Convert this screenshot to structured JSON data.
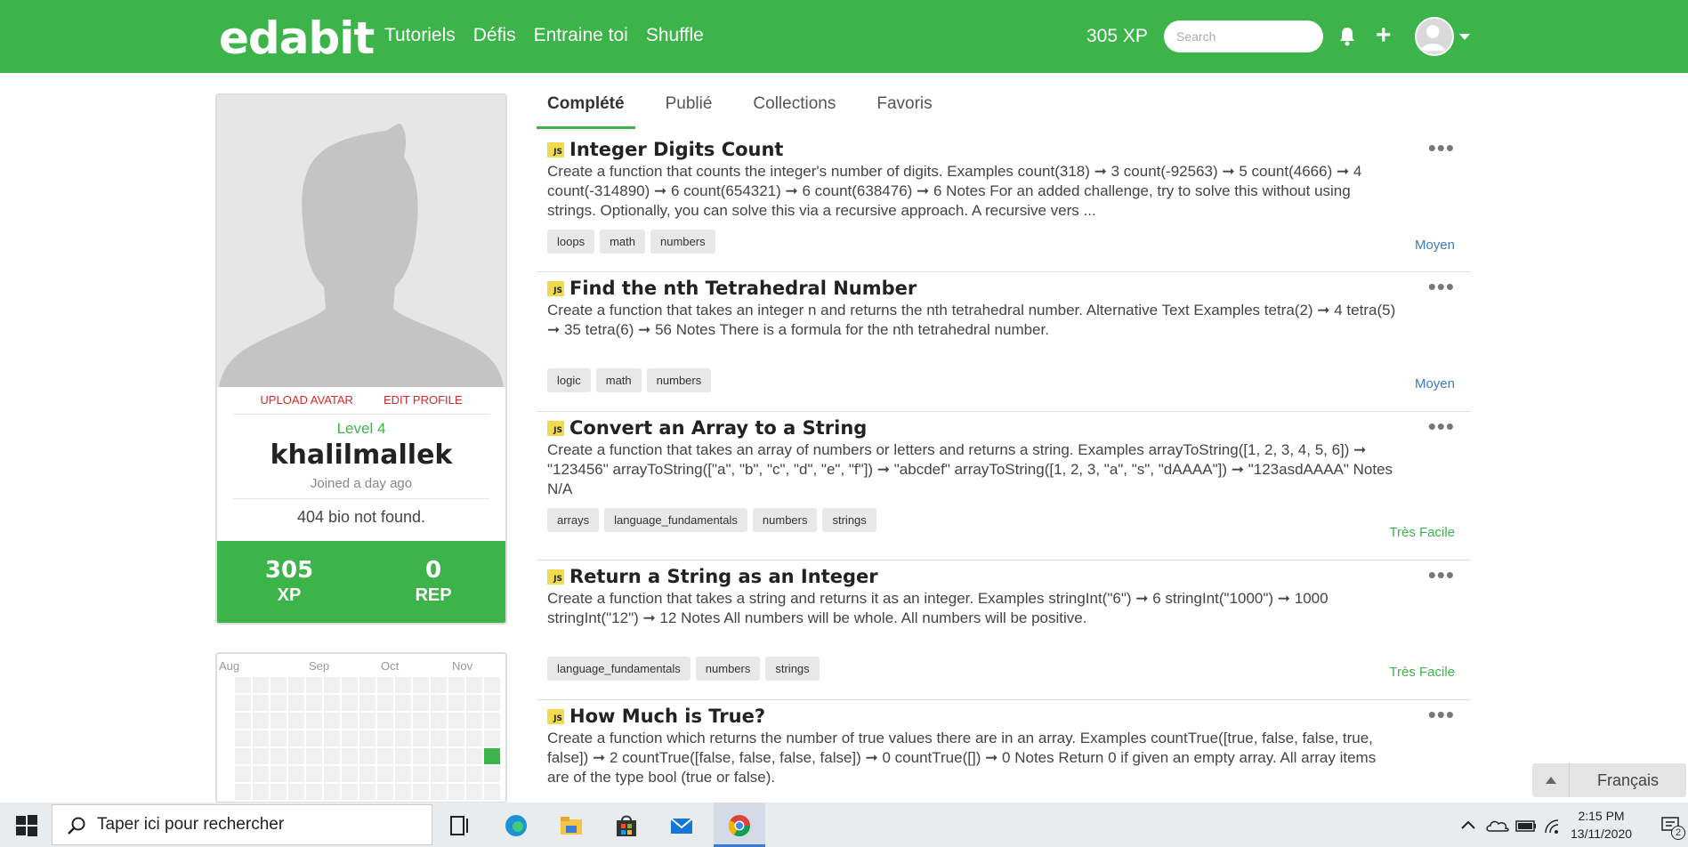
{
  "nav": {
    "brand": "edabit",
    "links": [
      "Tutoriels",
      "Défis",
      "Entraine toi",
      "Shuffle"
    ],
    "xp": "305 XP",
    "search_placeholder": "Search",
    "icons": [
      "bell-icon",
      "plus-icon",
      "avatar",
      "caret-down-icon"
    ]
  },
  "profile": {
    "upload_avatar": "UPLOAD AVATAR",
    "edit_profile": "EDIT PROFILE",
    "level": "Level 4",
    "username": "khalilmallek",
    "joined": "Joined a day ago",
    "bio": "404 bio not found.",
    "stats": [
      {
        "value": "305",
        "label": "XP"
      },
      {
        "value": "0",
        "label": "REP"
      }
    ]
  },
  "calendar": {
    "months": [
      "Aug",
      "Sep",
      "Oct",
      "Nov"
    ],
    "active_color": "#3cb449"
  },
  "tabs": [
    "Complété",
    "Publié",
    "Collections",
    "Favoris"
  ],
  "challenges": [
    {
      "lang": "JS",
      "title": "Integer Digits Count",
      "description": "Create a function that counts the integer's number of digits. Examples count(318) ➞ 3 count(-92563) ➞ 5 count(4666) ➞ 4 count(-314890) ➞ 6 count(654321) ➞ 6 count(638476) ➞ 6 Notes For an added challenge, try to solve this without using strings. Optionally, you can solve this via a recursive approach. A recursive vers ...",
      "tags": [
        "loops",
        "math",
        "numbers"
      ],
      "difficulty": "Moyen"
    },
    {
      "lang": "JS",
      "title": "Find the nth Tetrahedral Number",
      "description": "Create a function that takes an integer n and returns the nth tetrahedral number. Alternative Text Examples tetra(2) ➞ 4 tetra(5) ➞ 35 tetra(6) ➞ 56 Notes There is a formula for the nth tetrahedral number.",
      "tags": [
        "logic",
        "math",
        "numbers"
      ],
      "difficulty": "Moyen"
    },
    {
      "lang": "JS",
      "title": "Convert an Array to a String",
      "description": "Create a function that takes an array of numbers or letters and returns a string. Examples arrayToString([1, 2, 3, 4, 5, 6]) ➞ \"123456\" arrayToString([\"a\", \"b\", \"c\", \"d\", \"e\", \"f\"]) ➞ \"abcdef\" arrayToString([1, 2, 3, \"a\", \"s\", \"dAAAA\"]) ➞ \"123asdAAAA\" Notes N/A",
      "tags": [
        "arrays",
        "language_fundamentals",
        "numbers",
        "strings"
      ],
      "difficulty": "Très Facile"
    },
    {
      "lang": "JS",
      "title": "Return a String as an Integer",
      "description": "Create a function that takes a string and returns it as an integer. Examples stringInt(\"6\") ➞ 6 stringInt(\"1000\") ➞ 1000 stringInt(\"12\") ➞ 12 Notes All numbers will be whole. All numbers will be positive.",
      "tags": [
        "language_fundamentals",
        "numbers",
        "strings"
      ],
      "difficulty": "Très Facile"
    },
    {
      "lang": "JS",
      "title": "How Much is True?",
      "description": "Create a function which returns the number of true values there are in an array. Examples countTrue([true, false, false, true, false]) ➞ 2 countTrue([false, false, false, false]) ➞ 0 countTrue([]) ➞ 0 Notes Return 0 if given an empty array. All array items are of the type bool (true or false).",
      "tags": [],
      "difficulty": ""
    }
  ],
  "language_selector": {
    "label": "Français"
  },
  "taskbar": {
    "search_text": "Taper ici pour rechercher",
    "time": "2:15 PM",
    "date": "13/11/2020",
    "notification_count": "2"
  },
  "colors": {
    "brand_green": "#3cb449",
    "moyen_blue": "#3a7bbf",
    "error_red": "#d62828"
  }
}
